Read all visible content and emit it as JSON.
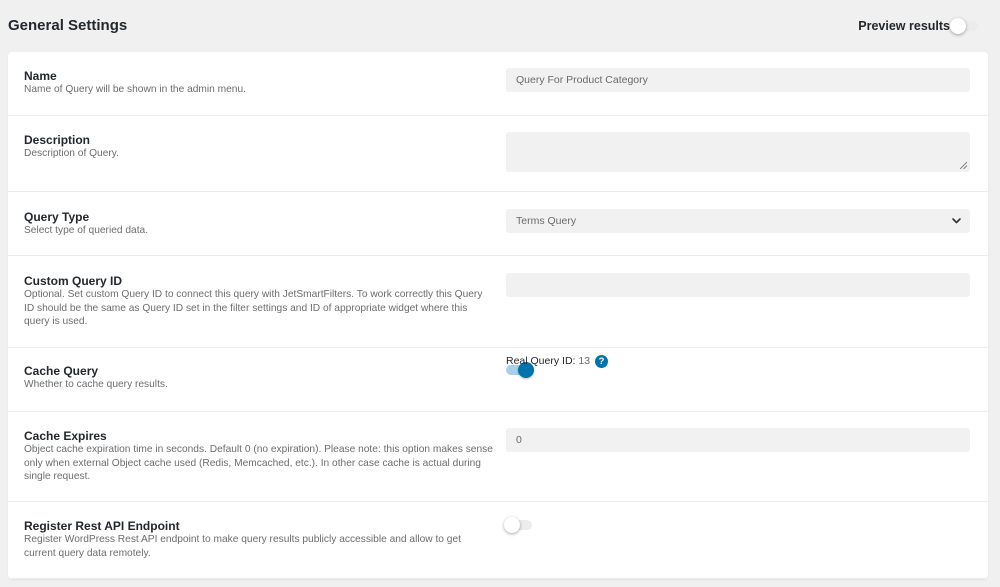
{
  "header": {
    "title": "General Settings",
    "preview_label": "Preview results",
    "preview_enabled": false
  },
  "fields": {
    "name": {
      "label": "Name",
      "description": "Name of Query will be shown in the admin menu.",
      "value": "Query For Product Category"
    },
    "description": {
      "label": "Description",
      "description": "Description of Query.",
      "value": ""
    },
    "query_type": {
      "label": "Query Type",
      "description": "Select type of queried data.",
      "selected": "Terms Query"
    },
    "custom_query_id": {
      "label": "Custom Query ID",
      "description": "Optional. Set custom Query ID to connect this query with JetSmartFilters. To work correctly this Query ID should be the same as Query ID set in the filter settings and ID of appropriate widget where this query is used.",
      "value": "",
      "real_id_label": "Real Query ID:",
      "real_id_value": "13",
      "help_glyph": "?"
    },
    "cache_query": {
      "label": "Cache Query",
      "description": "Whether to cache query results.",
      "enabled": true
    },
    "cache_expires": {
      "label": "Cache Expires",
      "description": "Object cache expiration time in seconds. Default 0 (no expiration). Please note: this option makes sense only when external Object cache used (Redis, Memcached, etc.). In other case cache is actual during single request.",
      "value": "0"
    },
    "register_rest": {
      "label": "Register Rest API Endpoint",
      "description": "Register WordPress Rest API endpoint to make query results publicly accessible and allow to get current query data remotely.",
      "enabled": false
    }
  },
  "colors": {
    "accent": "#0073aa",
    "background": "#f0f0f1",
    "field_bg": "#f1f1f1"
  },
  "icons": {
    "select": "chevron-down-icon",
    "textarea": "resize-grip-icon",
    "help": "question-circle-icon"
  }
}
